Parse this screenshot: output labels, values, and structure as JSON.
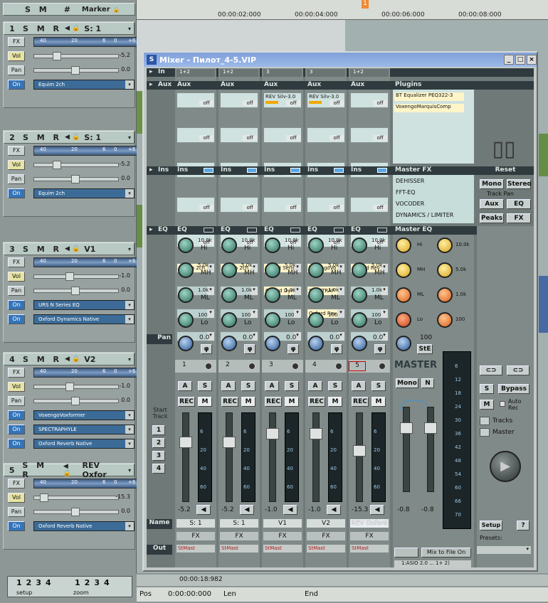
{
  "marker_bar": {
    "sms": "S M",
    "hash": "#",
    "marker": "Marker"
  },
  "timeline": {
    "ticks": [
      "00:00:02:000",
      "00:00:04:000",
      "00:00:06:000",
      "00:00:08:000"
    ],
    "marker_flag": "1"
  },
  "tracks": [
    {
      "num": "1",
      "sms": "S M R",
      "name": "S: 1",
      "fx": "FX",
      "vol_label": "Vol",
      "vol": "-5.2",
      "pan_label": "Pan",
      "pan": "0.0",
      "plugins": [
        "Equim 2ch"
      ]
    },
    {
      "num": "2",
      "sms": "S M R",
      "name": "S: 1",
      "fx": "FX",
      "vol_label": "Vol",
      "vol": "-5.2",
      "pan_label": "Pan",
      "pan": "0.0",
      "plugins": [
        "Equim 2ch"
      ]
    },
    {
      "num": "3",
      "sms": "S M R",
      "name": "V1",
      "fx": "FX",
      "vol_label": "Vol",
      "vol": "-1.0",
      "pan_label": "Pan",
      "pan": "0.0",
      "plugins": [
        "URS N Series EQ",
        "Oxford Dynamics Native"
      ]
    },
    {
      "num": "4",
      "sms": "S M R",
      "name": "V2",
      "fx": "FX",
      "vol_label": "Vol",
      "vol": "-1.0",
      "pan_label": "Pan",
      "pan": "0.0",
      "plugins": [
        "VoxengoVoxformer",
        "SPECTRAPHYLE",
        "Oxford Reverb Native"
      ]
    },
    {
      "num": "5",
      "sms": "S M R",
      "name": "REV Oxfor",
      "fx": "FX",
      "vol_label": "Vol",
      "vol": "-15.3",
      "pan_label": "Pan",
      "pan": "0.0",
      "plugins": [
        "Oxford Reverb Native"
      ]
    }
  ],
  "on_label": "On",
  "meter_scale": [
    "40",
    "20",
    "6",
    "0",
    "+6"
  ],
  "mixer": {
    "title": "Mixer - Пилот_4-5.VIP",
    "in_label": "In",
    "aux_label": "Aux",
    "ins_label": "Ins",
    "eq_label": "EQ",
    "pan_label": "Pan",
    "name_label": "Name",
    "out_label": "Out",
    "off": "off",
    "channels": [
      {
        "in": "1+2",
        "aux_sends": [],
        "ins": [
          "Equim 2ch"
        ],
        "num": "1",
        "pan": "0.0",
        "fval": "-5.2",
        "name": "S: 1",
        "fx": "FX",
        "out": "StMast"
      },
      {
        "in": "1+2",
        "aux_sends": [],
        "ins": [
          "Equim 2ch"
        ],
        "num": "2",
        "pan": "0.0",
        "fval": "-5.2",
        "name": "S: 1",
        "fx": "FX",
        "out": "StMast"
      },
      {
        "in": "3",
        "aux_sends": [
          "REV Silv-3.0"
        ],
        "ins": [
          "URS N Serie",
          "Oxford Dyn"
        ],
        "num": "3",
        "pan": "0.0",
        "fval": "-1.0",
        "name": "V1",
        "fx": "FX",
        "out": "StMast"
      },
      {
        "in": "3",
        "aux_sends": [
          "REV Silv-3.0"
        ],
        "ins": [
          "VoxengoVo",
          "SPECTRAP",
          "Oxford Rev"
        ],
        "num": "4",
        "pan": "0.0",
        "fval": "-1.0",
        "name": "V2",
        "fx": "FX",
        "out": "StMast"
      },
      {
        "in": "1+2",
        "aux_sends": [],
        "ins": [
          "Oxford Rev"
        ],
        "num": "5",
        "pan": "0.0",
        "fval": "-15.3",
        "name": "REV Oxford",
        "fx": "FX",
        "out": "StMast"
      }
    ],
    "eq_bands": [
      {
        "freq": "10.0k",
        "band": "Hi"
      },
      {
        "freq": "5.0k",
        "band": "MH"
      },
      {
        "freq": "1.0k",
        "band": "ML"
      },
      {
        "freq": "100",
        "band": "Lo"
      }
    ],
    "strip_buttons": {
      "a": "A",
      "s": "S",
      "rec": "REC",
      "m": "M",
      "phase": "φ"
    },
    "fader_scale": [
      "6",
      "20",
      "40",
      "60"
    ],
    "plugins_header": "Plugins",
    "plugins": [
      "BT Equalizer PEQ322-3",
      "VoxengoMarquisComp"
    ],
    "master_fx_header": "Master FX",
    "master_fx": [
      "DEHISSER",
      "FFT-EQ",
      "VOCODER",
      "DYNAMICS / LIMITER"
    ],
    "reset": "Reset",
    "mono": "Mono",
    "stereo": "Stereo",
    "track_pan": "Track Pan",
    "aux": "Aux",
    "eq": "EQ",
    "peaks": "Peaks",
    "fx": "FX",
    "master_eq_header": "Master EQ",
    "master_eq_freqs": [
      "10.0k",
      "5.0k",
      "1.0k",
      "100"
    ],
    "master_eq_bands": [
      "Hi",
      "MH",
      "ML",
      "Lo"
    ],
    "master_pan_val": "100",
    "ste": "StE",
    "master_label": "MASTER",
    "master_mono": "Mono",
    "master_n": "N",
    "master_fvals": [
      "-0.8",
      "-0.8"
    ],
    "master_scale": [
      "6",
      "12",
      "18",
      "24",
      "30",
      "36",
      "42",
      "48",
      "54",
      "60",
      "66",
      "70"
    ],
    "mix_to_file": "Mix to File",
    "mix_on": "On",
    "master_out": "1:ASIO 2.0 ... 1+ 2)",
    "start_track": "Start Track",
    "start_track_nums": [
      "1",
      "2",
      "3",
      "4"
    ],
    "right_s": "S",
    "bypass": "Bypass",
    "right_m": "M",
    "auto_rec": "Auto Rec",
    "tracks_label": "Tracks",
    "master_chk_label": "Master",
    "setup": "Setup",
    "help": "?",
    "presets": "Presets:"
  },
  "bottom": {
    "setup_nums": [
      "1",
      "2",
      "3",
      "4"
    ],
    "zoom_nums": [
      "1",
      "2",
      "3",
      "4"
    ],
    "setup_label": "setup",
    "zoom_label": "zoom",
    "time": "00:00:18:982",
    "pos_label": "Pos",
    "pos_value": "0:00:00:000",
    "len_label": "Len",
    "end_label": "End"
  },
  "colors": {
    "accent": "#3474b8",
    "header_bg": "#b9c9c3",
    "mixer_bg": "#6f7977",
    "eq_green": "#2e7060",
    "master_yellow": "#d7a320",
    "master_orange": "#d9621a"
  }
}
